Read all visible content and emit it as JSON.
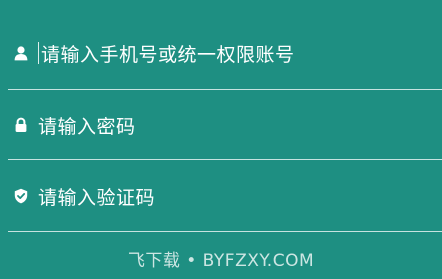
{
  "form": {
    "username_placeholder": "请输入手机号或统一权限账号",
    "password_placeholder": "请输入密码",
    "captcha_placeholder": "请输入验证码"
  },
  "icons": {
    "username": "user-icon",
    "password": "lock-icon",
    "captcha": "shield-check-icon"
  },
  "colors": {
    "background": "#1e8f82",
    "text": "#ffffff"
  },
  "watermark": "飞下载 • BYFZXY.COM"
}
